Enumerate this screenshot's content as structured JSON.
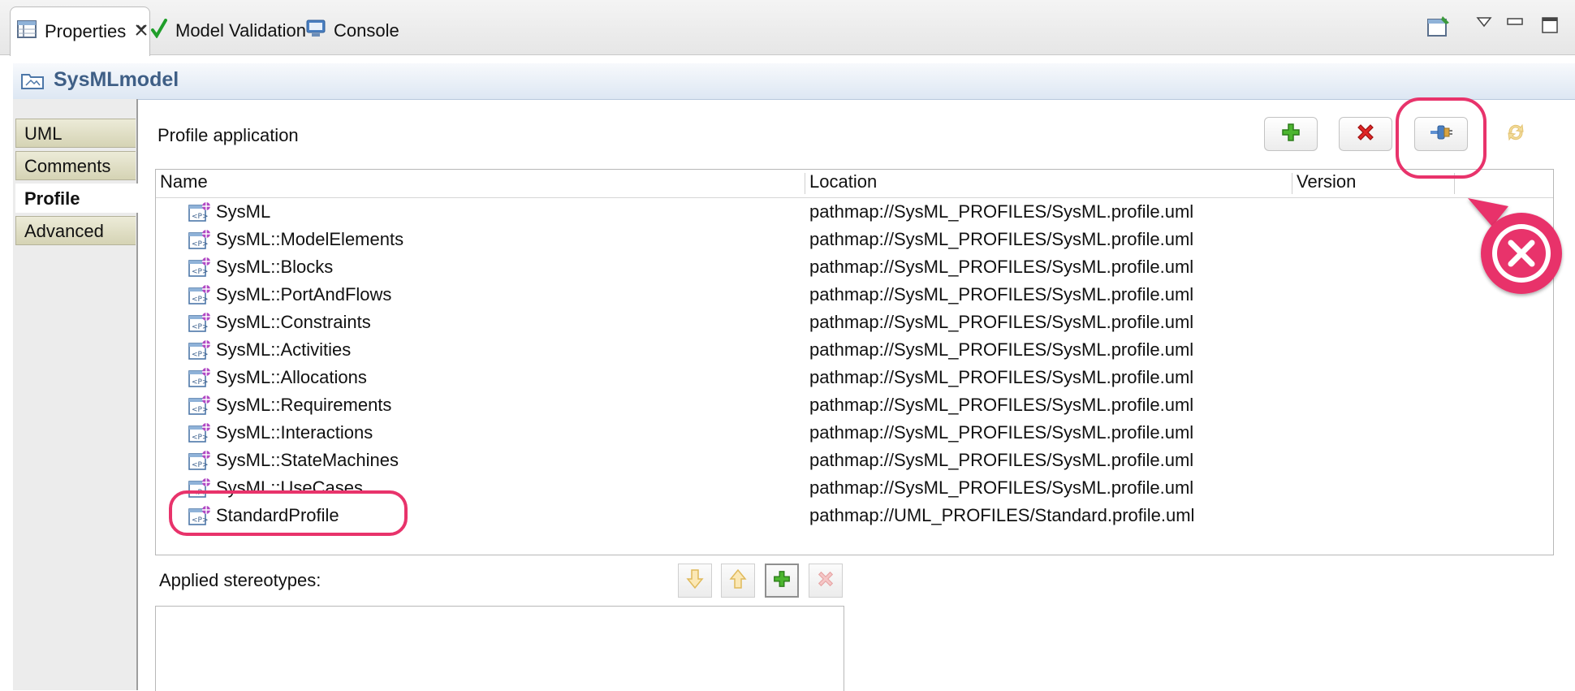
{
  "tabs": [
    {
      "label": "Properties"
    },
    {
      "label": "Model Validation"
    },
    {
      "label": "Console"
    }
  ],
  "title": "SysMLmodel",
  "categories": [
    {
      "label": "UML"
    },
    {
      "label": "Comments"
    },
    {
      "label": "Profile"
    },
    {
      "label": "Advanced"
    }
  ],
  "profile_application": {
    "label": "Profile application",
    "columns": {
      "name": "Name",
      "location": "Location",
      "version": "Version"
    },
    "rows": [
      {
        "name": "SysML",
        "location": "pathmap://SysML_PROFILES/SysML.profile.uml"
      },
      {
        "name": "SysML::ModelElements",
        "location": "pathmap://SysML_PROFILES/SysML.profile.uml"
      },
      {
        "name": "SysML::Blocks",
        "location": "pathmap://SysML_PROFILES/SysML.profile.uml"
      },
      {
        "name": "SysML::PortAndFlows",
        "location": "pathmap://SysML_PROFILES/SysML.profile.uml"
      },
      {
        "name": "SysML::Constraints",
        "location": "pathmap://SysML_PROFILES/SysML.profile.uml"
      },
      {
        "name": "SysML::Activities",
        "location": "pathmap://SysML_PROFILES/SysML.profile.uml"
      },
      {
        "name": "SysML::Allocations",
        "location": "pathmap://SysML_PROFILES/SysML.profile.uml"
      },
      {
        "name": "SysML::Requirements",
        "location": "pathmap://SysML_PROFILES/SysML.profile.uml"
      },
      {
        "name": "SysML::Interactions",
        "location": "pathmap://SysML_PROFILES/SysML.profile.uml"
      },
      {
        "name": "SysML::StateMachines",
        "location": "pathmap://SysML_PROFILES/SysML.profile.uml"
      },
      {
        "name": "SysML::UseCases",
        "location": "pathmap://SysML_PROFILES/SysML.profile.uml"
      },
      {
        "name": "StandardProfile",
        "location": "pathmap://UML_PROFILES/Standard.profile.uml"
      }
    ]
  },
  "applied_stereotypes": {
    "label": "Applied stereotypes:"
  },
  "colors": {
    "highlight": "#e8336b",
    "title_text": "#3f5f86",
    "add_green": "#2e9e1f",
    "delete_red": "#d81f1f",
    "disabled": "#f1c9c9"
  },
  "icons": [
    "properties-icon",
    "close-icon",
    "checkmark-icon",
    "console-icon",
    "pin-icon",
    "view-menu-icon",
    "minimize-icon",
    "maximize-icon",
    "model-icon",
    "add-icon",
    "delete-icon",
    "apply-profile-icon",
    "refresh-icon",
    "profile-icon",
    "arrow-down-icon",
    "arrow-up-icon"
  ]
}
